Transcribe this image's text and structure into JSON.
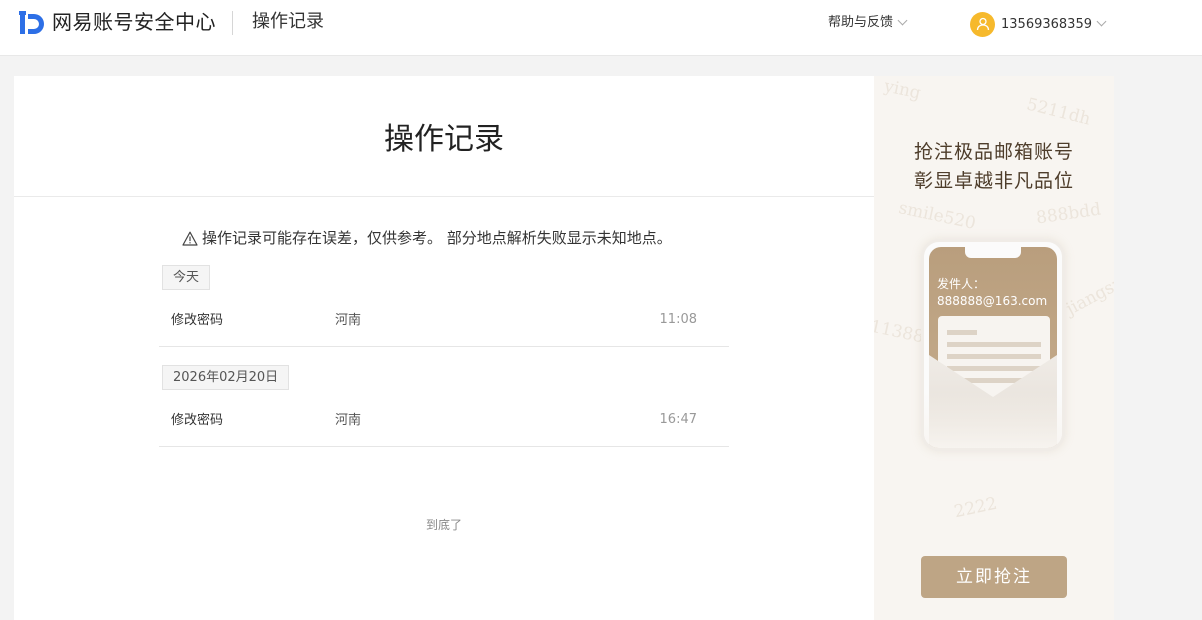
{
  "header": {
    "logo_text": "网易账号安全中心",
    "page_name": "操作记录",
    "help_label": "帮助与反馈",
    "user_phone": "13569368359",
    "icons": {
      "logo": "netease-id-logo-icon",
      "help_dropdown": "chevron-down-icon",
      "avatar": "user-avatar-icon",
      "user_dropdown": "chevron-down-icon"
    }
  },
  "main": {
    "title": "操作记录",
    "notice": "操作记录可能存在误差，仅供参考。 部分地点解析失败显示未知地点。",
    "notice_icon": "warning-icon",
    "groups": [
      {
        "date": "今天",
        "records": [
          {
            "operation": "修改密码",
            "location": "河南",
            "time": "11:08"
          }
        ]
      },
      {
        "date": "2026年02月20日",
        "records": [
          {
            "operation": "修改密码",
            "location": "河南",
            "time": "16:47"
          }
        ]
      }
    ],
    "end_text": "到底了"
  },
  "ad": {
    "headline_1": "抢注极品邮箱账号",
    "headline_2": "彰显卓越非凡品位",
    "sender_label": "发件人：",
    "sender_email": "888888@163.com",
    "cta_label": "立即抢注",
    "watermarks": [
      "5211dh",
      "smile520",
      "888bdd",
      "11388",
      "jiangsu",
      "2222",
      "ying"
    ]
  },
  "colors": {
    "accent_blue": "#2d6fe6",
    "avatar_yellow": "#f6b92c",
    "ad_button": "#bea585",
    "ad_background": "#f8f5f1"
  }
}
